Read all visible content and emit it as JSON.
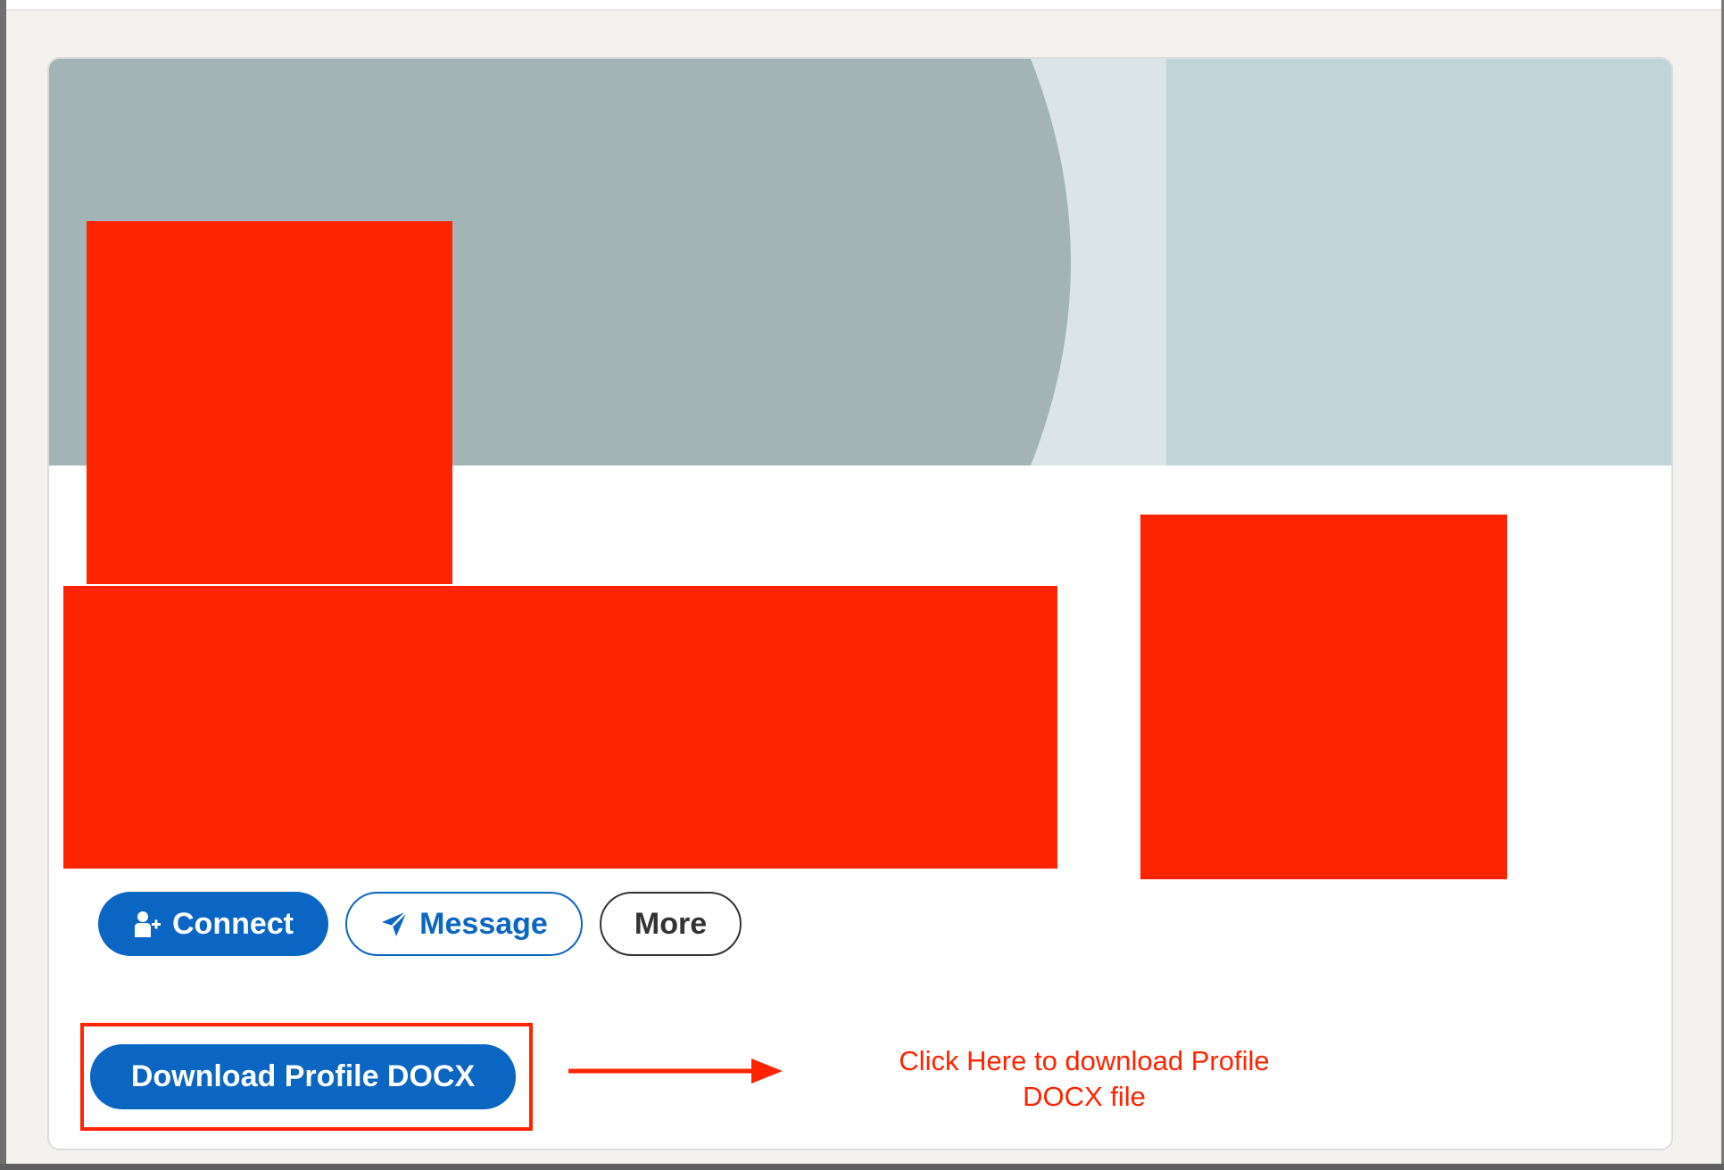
{
  "profile": {
    "actions": {
      "connect_label": "Connect",
      "message_label": "Message",
      "more_label": "More"
    },
    "download": {
      "button_label": "Download Profile DOCX"
    }
  },
  "annotation": {
    "line1": "Click Here to download Profile",
    "line2": "DOCX file"
  },
  "colors": {
    "primary_blue": "#0a66c2",
    "redaction_red": "#ff2400",
    "cover_gray": "#a2b4b6",
    "cover_light": "#dbe5e7",
    "cover_blue_gray": "#c0d5d8"
  },
  "icons": {
    "connect": "person-add-icon",
    "message": "send-icon",
    "arrow": "arrow-right-icon"
  }
}
